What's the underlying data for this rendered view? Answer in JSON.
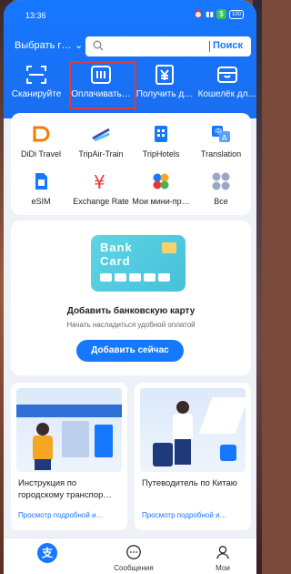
{
  "status": {
    "time": "13:36",
    "battery": "100"
  },
  "header": {
    "city": "Выбрать г…",
    "search_placeholder": "",
    "search_button": "Поиск"
  },
  "quick": [
    {
      "label": "Сканируйте",
      "icon": "scan-icon"
    },
    {
      "label": "Оплачивать…",
      "icon": "pay-barcode-icon"
    },
    {
      "label": "Получить д…",
      "icon": "receive-money-icon"
    },
    {
      "label": "Кошелёк дл…",
      "icon": "wallet-icon"
    }
  ],
  "services": [
    {
      "label": "DiDi Travel",
      "icon": "didi-icon",
      "color": "#f57c00"
    },
    {
      "label": "TripAir-Train",
      "icon": "train-icon",
      "color": "#3f51b5"
    },
    {
      "label": "TripHotels",
      "icon": "hotel-icon",
      "color": "#1677ff"
    },
    {
      "label": "Translation",
      "icon": "translate-icon",
      "color": "#1677ff"
    },
    {
      "label": "eSIM",
      "icon": "esim-icon",
      "color": "#1677ff"
    },
    {
      "label": "Exchange Rate",
      "icon": "exchange-icon",
      "color": "#e53935"
    },
    {
      "label": "Мои мини-пр…",
      "icon": "miniapps-icon",
      "color": "#f5a623"
    },
    {
      "label": "Все",
      "icon": "all-apps-icon",
      "color": "#9aa8c6"
    }
  ],
  "bank": {
    "card_text": "Bank Card",
    "title": "Добавить банковскую карту",
    "subtitle": "Начать насладиться удобной оплатой",
    "button": "Добавить сейчас"
  },
  "guides": [
    {
      "title": "Инструкция по городскому транспор…",
      "link": "Просмотр подробной и…"
    },
    {
      "title": "Путеводитель по Китаю",
      "link": "Просмотр подробной и…"
    }
  ],
  "tabs": [
    {
      "label": ""
    },
    {
      "label": "Сообщения"
    },
    {
      "label": "Мои"
    }
  ],
  "colors": {
    "brand": "#1677ff",
    "highlight": "#e53935"
  }
}
